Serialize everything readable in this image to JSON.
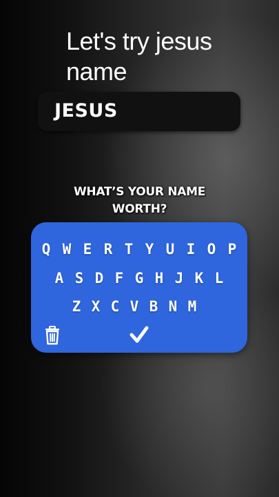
{
  "caption": {
    "text": "Let's try jesus name"
  },
  "name_field": {
    "value": "JESUS"
  },
  "prompt": {
    "line1": "WHAT’S YOUR NAME",
    "line2": "WORTH?"
  },
  "keyboard": {
    "background_color": "#2f66dd",
    "rows": [
      [
        "Q",
        "W",
        "E",
        "R",
        "T",
        "Y",
        "U",
        "I",
        "O",
        "P"
      ],
      [
        "A",
        "S",
        "D",
        "F",
        "G",
        "H",
        "J",
        "K",
        "L"
      ],
      [
        "Z",
        "X",
        "C",
        "V",
        "B",
        "N",
        "M"
      ]
    ],
    "delete_icon": "trash-icon",
    "confirm_icon": "checkmark-icon"
  }
}
